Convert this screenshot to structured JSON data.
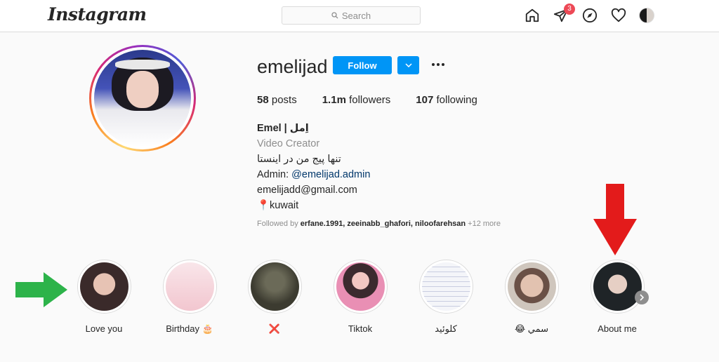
{
  "app": {
    "logo": "Instagram"
  },
  "search": {
    "placeholder": "Search"
  },
  "nav": {
    "direct_badge": "3"
  },
  "profile": {
    "username": "emelijad",
    "follow_label": "Follow",
    "stats": {
      "posts_count": "58",
      "posts_label": "posts",
      "followers_count": "1.1m",
      "followers_label": "followers",
      "following_count": "107",
      "following_label": "following"
    },
    "bio": {
      "name": "Emel | اِمل",
      "category": "Video Creator",
      "line1": "تنها پیج من در اینستا",
      "admin_prefix": "Admin: ",
      "admin_link": "@emelijad.admin",
      "email": "emelijadd@gmail.com",
      "location": "📍kuwait"
    },
    "followed_by": {
      "prefix": "Followed by ",
      "users": "erfane.1991, zeeinabb_ghafori, niloofarehsan",
      "more": " +12 more"
    }
  },
  "highlights": [
    {
      "label": "Love you",
      "color": "#3a2a2a"
    },
    {
      "label": "Birthday 🎂",
      "color": "#f4d7dc"
    },
    {
      "label": "❌",
      "color": "#4a4a3c"
    },
    {
      "label": "Tiktok",
      "color": "#d98ba8"
    },
    {
      "label": "كلوئيد",
      "color": "#eef0f5"
    },
    {
      "label": "😂 سمي",
      "color": "#c9b7aa"
    },
    {
      "label": "About me",
      "color": "#2a3236"
    }
  ],
  "colors": {
    "accent": "#0095f6",
    "badge": "#ed4956",
    "green_arrow": "#2db34a",
    "red_arrow": "#e31b1b"
  }
}
